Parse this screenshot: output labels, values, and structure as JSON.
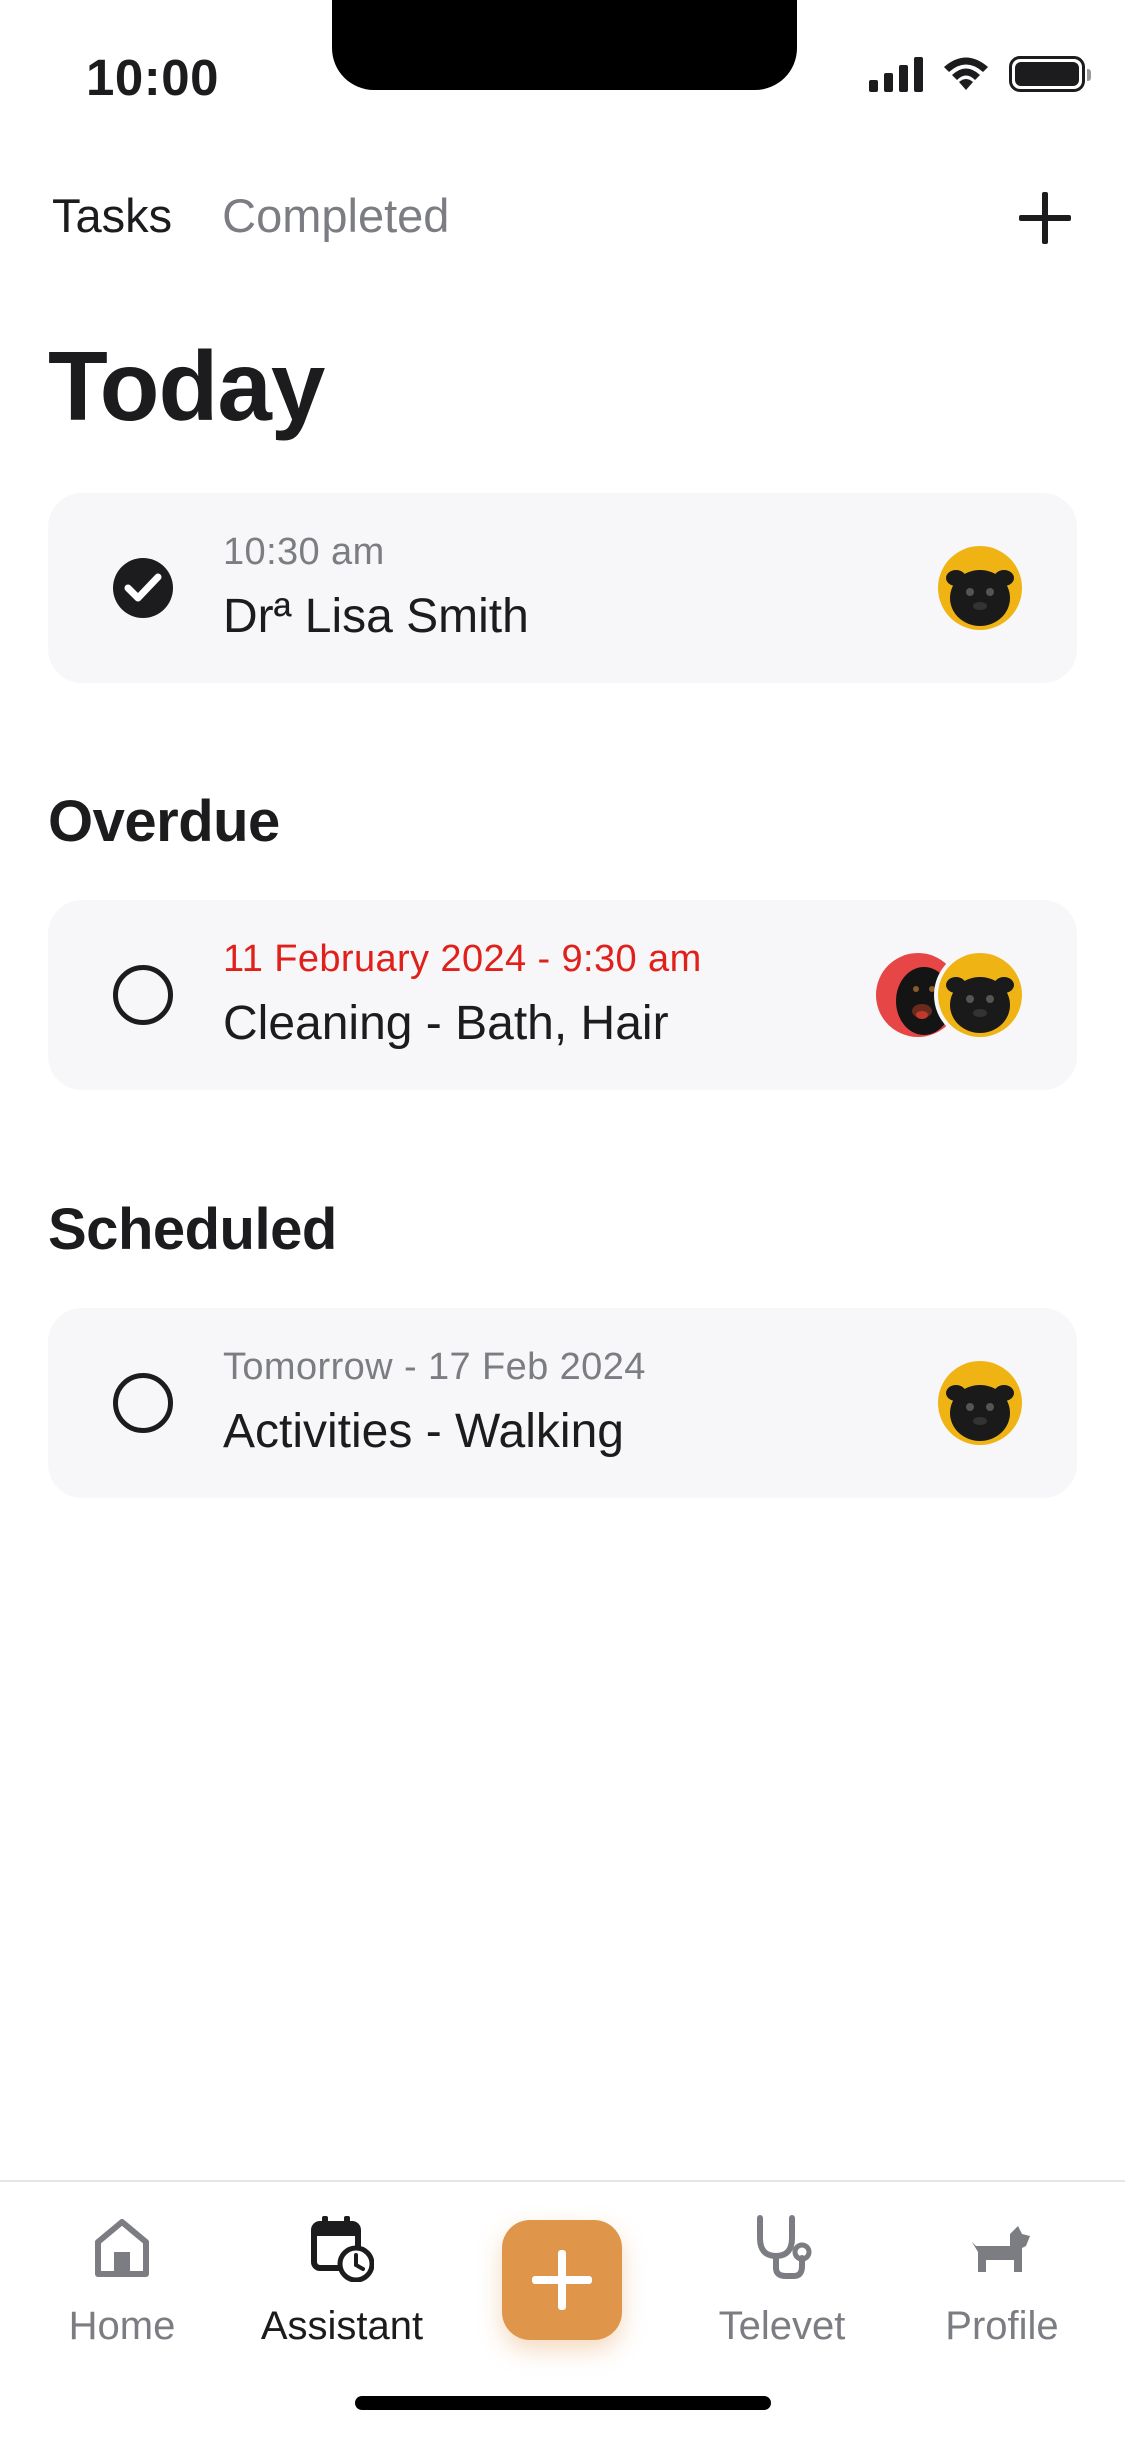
{
  "status_bar": {
    "time": "10:00"
  },
  "top_tabs": [
    {
      "label": "Tasks",
      "active": true
    },
    {
      "label": "Completed",
      "active": false
    }
  ],
  "sections": {
    "today": {
      "title": "Today",
      "tasks": [
        {
          "subtitle": "10:30 am",
          "title": "Drª Lisa Smith",
          "done": true,
          "pets": [
            "pug"
          ]
        }
      ]
    },
    "overdue": {
      "title": "Overdue",
      "tasks": [
        {
          "subtitle": "11 February 2024 - 9:30 am",
          "title": "Cleaning - Bath, Hair",
          "done": false,
          "pets": [
            "rottweiler",
            "pug"
          ]
        }
      ]
    },
    "scheduled": {
      "title": "Scheduled",
      "tasks": [
        {
          "subtitle": "Tomorrow - 17 Feb 2024",
          "title": "Activities - Walking",
          "done": false,
          "pets": [
            "pug"
          ]
        }
      ]
    }
  },
  "bottom_nav": [
    {
      "label": "Home",
      "icon": "home-icon",
      "active": false
    },
    {
      "label": "Assistant",
      "icon": "calendar-clock-icon",
      "active": true
    },
    {
      "label": "Televet",
      "icon": "stethoscope-icon",
      "active": false
    },
    {
      "label": "Profile",
      "icon": "dog-icon",
      "active": false
    }
  ],
  "colors": {
    "accent": "#df964b",
    "overdue": "#e0201a",
    "card_bg": "#f7f7f9",
    "pug_avatar_bg": "#efb414",
    "rottweiler_avatar_bg": "#e64646"
  }
}
